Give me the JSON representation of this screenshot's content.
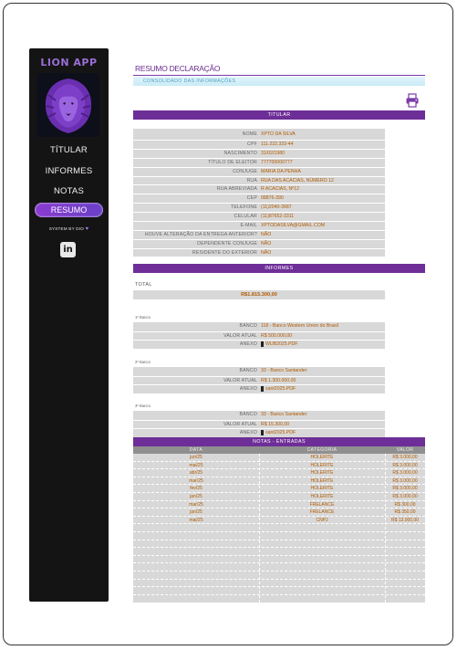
{
  "sidebar": {
    "app_title": "LION APP",
    "nav": [
      {
        "label": "TÍTULAR"
      },
      {
        "label": "INFORMES"
      },
      {
        "label": "NOTAS"
      },
      {
        "label": "RESUMO"
      }
    ],
    "system_by": "SYSTEM BY DIO",
    "linkedin_icon": "linkedin-icon"
  },
  "header": {
    "title": "RESUMO DECLARAÇÃO",
    "subtitle": "CONSOLIDADO DAS INFORMAÇÕES",
    "print_icon": "printer-icon"
  },
  "titular": {
    "section_title": "TITULAR",
    "fields": [
      {
        "key": "NOME",
        "value": "XPTO DA SILVA"
      },
      {
        "key": "CPF",
        "value": "111.222.333-44"
      },
      {
        "key": "NASCIMENTO",
        "value": "31/02/1980"
      },
      {
        "key": "TÍTULO DE ELEITOR",
        "value": "777700000777"
      },
      {
        "key": "CONJUGE",
        "value": "MARIA DA PENHA"
      },
      {
        "key": "RUA",
        "value": "RUA DAS ACACIAS, NÚMERO 12"
      },
      {
        "key": "RUA ABREVIADA",
        "value": "R ACACIAS, Nº12"
      },
      {
        "key": "CEP",
        "value": "08876-390"
      },
      {
        "key": "TELEFONE",
        "value": "(11)2040-3687"
      },
      {
        "key": "CELULAR",
        "value": "(11)87652-3311"
      },
      {
        "key": "E-MAIL",
        "value": "XPTODASILVA@GMAIL.COM"
      },
      {
        "key": "HOUVE ALTERAÇÃO DA ENTREGA ANTERIOR?",
        "value": "NÃO"
      },
      {
        "key": "DEPENDENTE CONJUGE",
        "value": "NÃO"
      },
      {
        "key": "RESIDENTE DO EXTERIOR",
        "value": "NÃO"
      }
    ]
  },
  "informes": {
    "section_title": "INFORMES",
    "total_label": "TOTAL",
    "total_value": "R$1.815.300,00",
    "banks": [
      {
        "caption": "1º Banco",
        "banco": "118 - Banco Western Union do Brasil",
        "valor": "R$ 500.000,00",
        "anexo": "WUB2025.PDF"
      },
      {
        "caption": "2º Banco",
        "banco": "33 - Banco Santander",
        "valor": "R$ 1.300.000,00",
        "anexo": "sant2025.PDF"
      },
      {
        "caption": "3º Banco",
        "banco": "33 - Banco Santander",
        "valor": "R$ 15.300,00",
        "anexo": "sant2025.PDF"
      }
    ],
    "labels": {
      "banco": "BANCO",
      "valor": "VALOR ATUAL",
      "anexo": "ANEXO"
    }
  },
  "notas": {
    "section_title": "NOTAS - ENTRADAS",
    "columns": [
      "DATA",
      "CATEGORIA",
      "VALOR"
    ],
    "rows": [
      {
        "data": "jun/25",
        "categoria": "HOLERITE",
        "valor": "R$ 3.000,00"
      },
      {
        "data": "mai/25",
        "categoria": "HOLERITE",
        "valor": "R$ 3.000,00"
      },
      {
        "data": "abr/25",
        "categoria": "HOLERITE",
        "valor": "R$ 3.000,00"
      },
      {
        "data": "mar/25",
        "categoria": "HOLERITE",
        "valor": "R$ 3.000,00"
      },
      {
        "data": "fev/25",
        "categoria": "HOLERITE",
        "valor": "R$ 3.000,00"
      },
      {
        "data": "jan/25",
        "categoria": "HOLERITE",
        "valor": "R$ 3.000,00"
      },
      {
        "data": "mar/25",
        "categoria": "FRELANCE",
        "valor": "R$ 300,00"
      },
      {
        "data": "jan/25",
        "categoria": "FRELANCE",
        "valor": "R$ 350,00"
      },
      {
        "data": "mai/25",
        "categoria": "CNPJ",
        "valor": "R$ 13.000,00"
      }
    ]
  },
  "colors": {
    "sidebar_bg": "#141414",
    "accent_purple": "#6e2e97",
    "value_orange": "#b05a00",
    "panel_gray": "#d8d8d8"
  }
}
